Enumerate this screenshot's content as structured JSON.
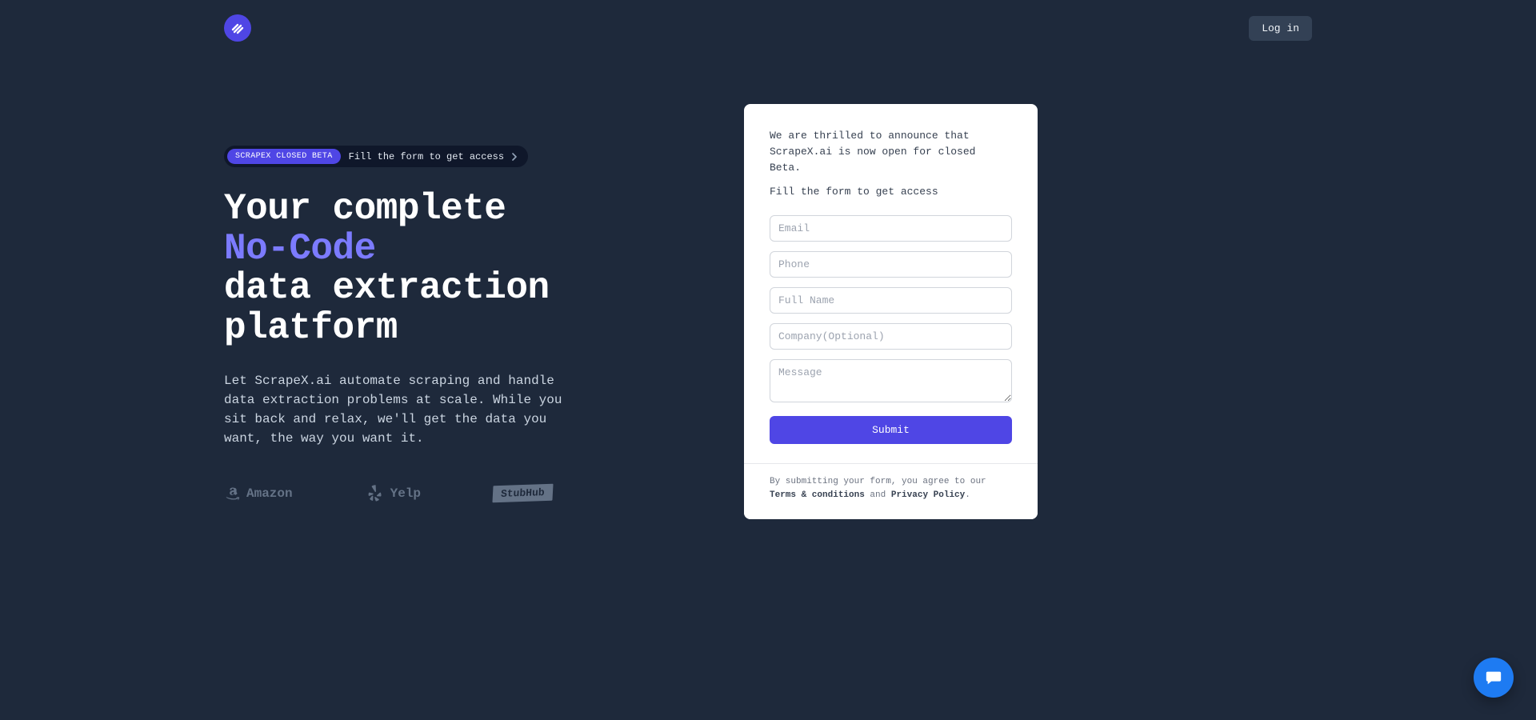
{
  "header": {
    "login_label": "Log in"
  },
  "badge": {
    "pill": "SCRAPEX CLOSED BETA",
    "text": "Fill the form to get access"
  },
  "headline": {
    "line1": "Your complete",
    "line2_accent": "No-Code",
    "line3": "data extraction platform"
  },
  "subtext": "Let ScrapeX.ai automate scraping and handle data extraction problems at scale. While you sit back and relax, we'll get the data you want, the way you want it.",
  "brands": {
    "amazon": "Amazon",
    "yelp": "Yelp",
    "stubhub": "StubHub"
  },
  "form": {
    "intro": "We are thrilled to announce that ScrapeX.ai is now open for closed Beta.",
    "sub": "Fill the form to get access",
    "placeholders": {
      "email": "Email",
      "phone": "Phone",
      "fullname": "Full Name",
      "company": "Company(Optional)",
      "message": "Message"
    },
    "submit_label": "Submit"
  },
  "legal": {
    "prefix": "By submitting your form, you agree to our ",
    "terms": "Terms & conditions",
    "and": " and ",
    "privacy": "Privacy Policy",
    "suffix": "."
  },
  "colors": {
    "accent": "#4F46E5",
    "bg": "#1E293B"
  }
}
